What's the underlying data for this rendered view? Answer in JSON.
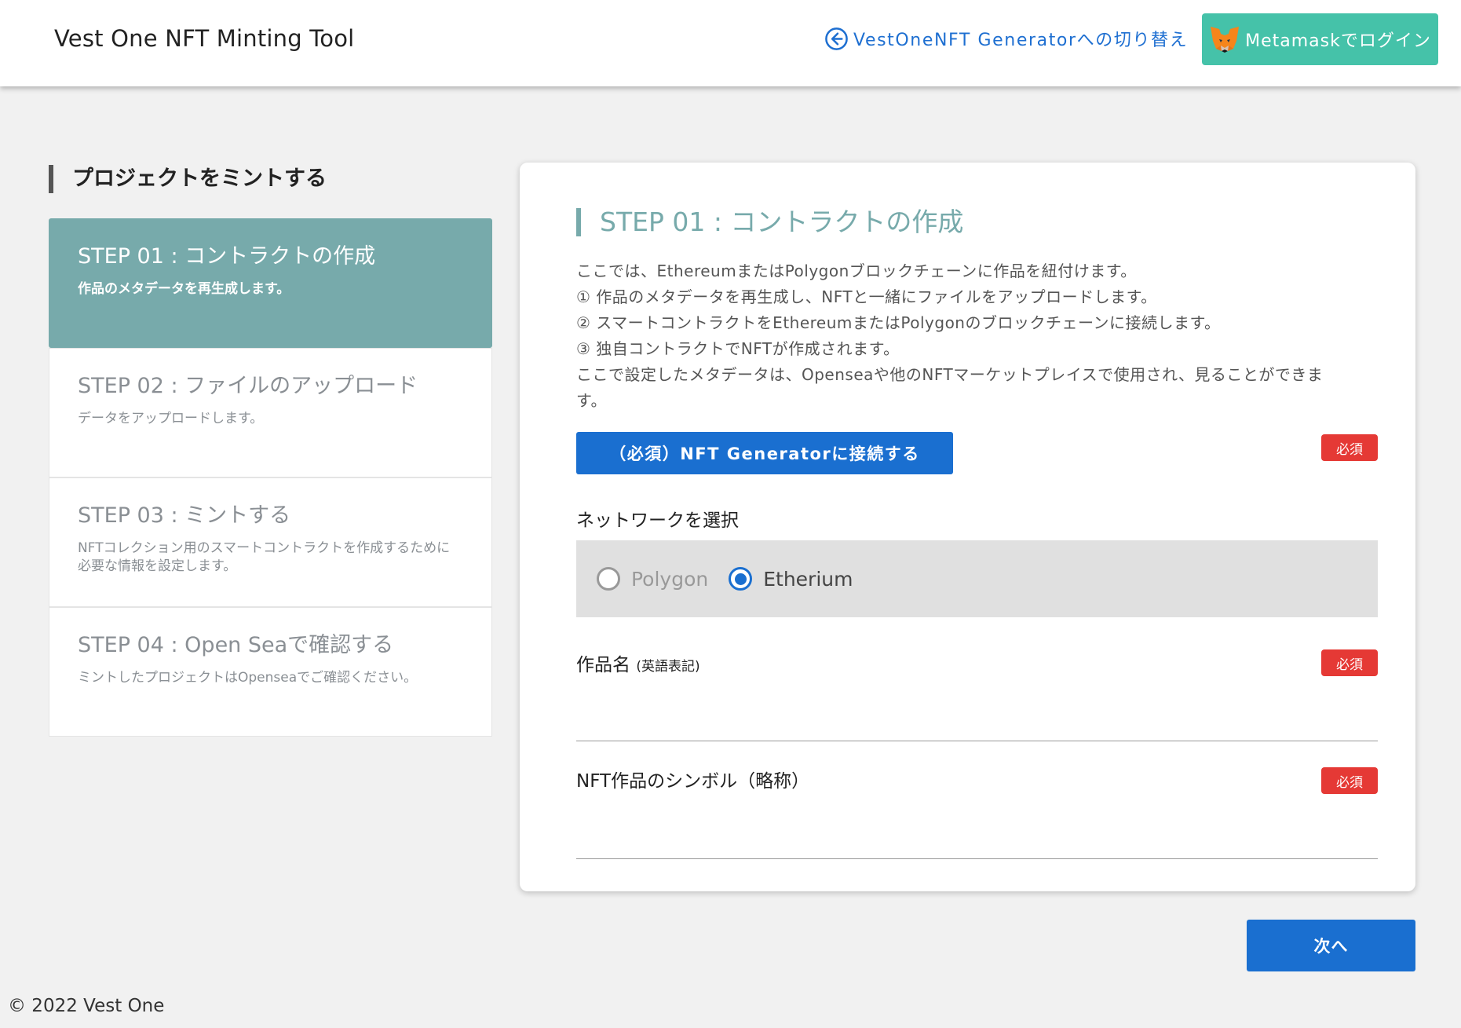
{
  "header": {
    "app_title": "Vest One NFT Minting Tool",
    "switch_label": "VestOneNFT Generatorへの切り替え",
    "login_label": "Metamaskでログイン"
  },
  "sidebar": {
    "heading": "プロジェクトをミントする",
    "steps": [
      {
        "title": "STEP 01 : コントラクトの作成",
        "desc": "作品のメタデータを再生成します。",
        "active": true
      },
      {
        "title": "STEP 02 : ファイルのアップロード",
        "desc": "データをアップロードします。",
        "active": false
      },
      {
        "title": "STEP 03 : ミントする",
        "desc": "NFTコレクション用のスマートコントラクトを作成するために必要な情報を設定します。",
        "active": false
      },
      {
        "title": "STEP 04 : Open Seaで確認する",
        "desc": "ミントしたプロジェクトはOpenseaでご確認ください。",
        "active": false
      }
    ]
  },
  "main": {
    "title": "STEP 01 : コントラクトの作成",
    "intro": [
      "ここでは、EthereumまたはPolygonブロックチェーンに作品を紐付けます。",
      "① 作品のメタデータを再生成し、NFTと一緒にファイルをアップロードします。",
      "② スマートコントラクトをEthereumまたはPolygonのブロックチェーンに接続します。",
      "③ 独自コントラクトでNFTが作成されます。",
      "ここで設定したメタデータは、Openseaや他のNFTマーケットプレイスで使用され、見ることができます。"
    ],
    "connect_label": "（必須）NFT Generatorに接続する",
    "required_badge": "必須",
    "network_label": "ネットワークを選択",
    "network_options": [
      {
        "label": "Polygon",
        "checked": false
      },
      {
        "label": "Etherium",
        "checked": true
      }
    ],
    "name_label": "作品名",
    "name_note": "(英語表記)",
    "name_value": "",
    "symbol_label": "NFT作品のシンボル（略称）",
    "symbol_value": ""
  },
  "next_label": "次へ",
  "footer": "© 2022 Vest One",
  "colors": {
    "accent_teal": "#77aaab",
    "primary_blue": "#1a6fd0",
    "login_green": "#45c2a9",
    "required_red": "#e53935"
  }
}
